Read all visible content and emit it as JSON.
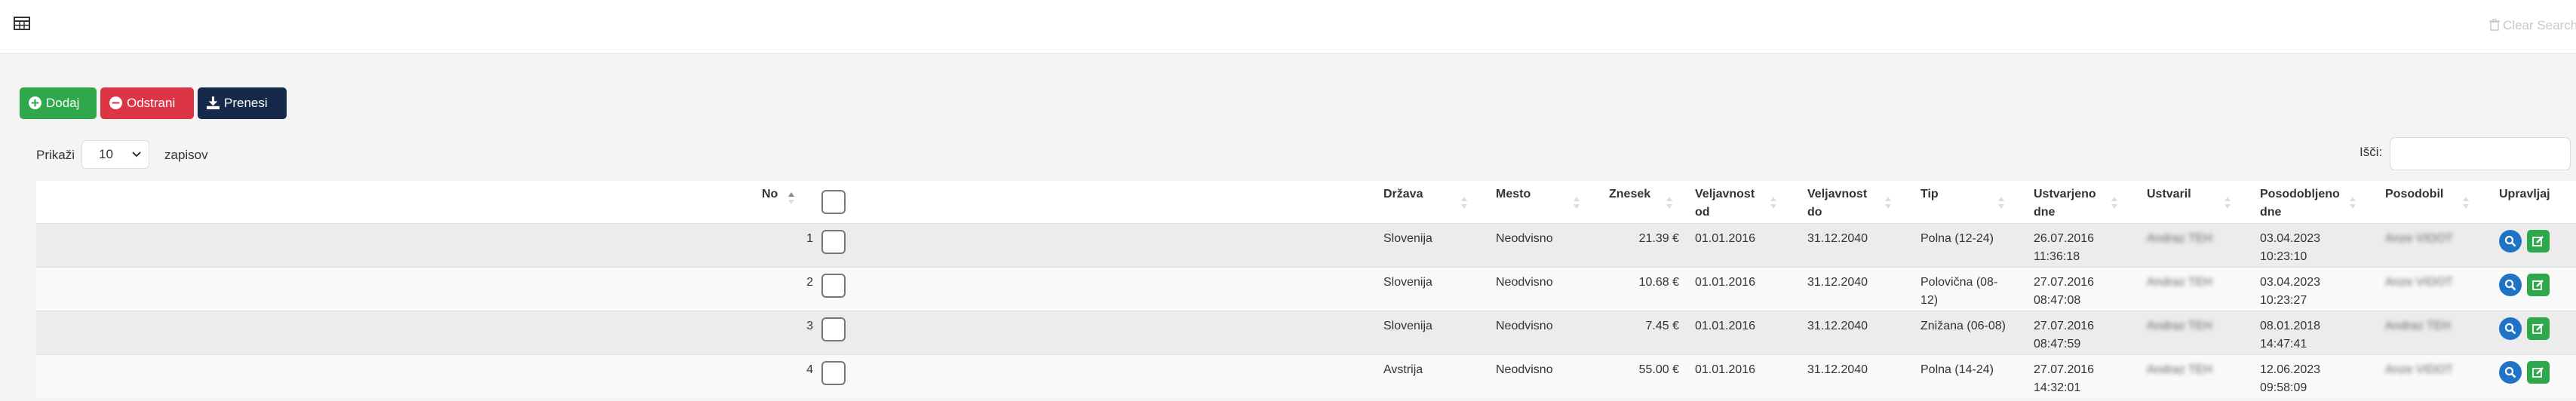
{
  "toolbar": {
    "clear_search_label": "Clear Search",
    "add_label": "Dodaj",
    "delete_label": "Odstrani",
    "download_label": "Prenesi"
  },
  "length": {
    "prefix": "Prikaži",
    "value": "10",
    "suffix": "zapisov"
  },
  "search": {
    "label": "Išči:",
    "value": ""
  },
  "columns": {
    "no": "No",
    "drzava": "Država",
    "mesto": "Mesto",
    "znesek": "Znesek",
    "velj_od": [
      "Veljavnost",
      "od"
    ],
    "velj_do": [
      "Veljavnost",
      "do"
    ],
    "tip": "Tip",
    "ustvarjeno": [
      "Ustvarjeno",
      "dne"
    ],
    "ustvaril": "Ustvaril",
    "posodobljeno": [
      "Posodobljeno",
      "dne"
    ],
    "posodobil": "Posodobil",
    "upravljaj": "Upravljaj"
  },
  "rows": [
    {
      "no": "1",
      "drzava": "Slovenija",
      "mesto": "Neodvisno",
      "znesek": "21.39 €",
      "od": "01.01.2016",
      "do": "31.12.2040",
      "tip": [
        "Polna (12-24)"
      ],
      "ustvarjeno": [
        "26.07.2016",
        "11:36:18"
      ],
      "ustvaril": "Andraz TEH",
      "posodobljeno": [
        "03.04.2023",
        "10:23:10"
      ],
      "posodobil": "Anze VIDOT"
    },
    {
      "no": "2",
      "drzava": "Slovenija",
      "mesto": "Neodvisno",
      "znesek": "10.68 €",
      "od": "01.01.2016",
      "do": "31.12.2040",
      "tip": [
        "Polovična (08-",
        "12)"
      ],
      "ustvarjeno": [
        "27.07.2016",
        "08:47:08"
      ],
      "ustvaril": "Andraz TEH",
      "posodobljeno": [
        "03.04.2023",
        "10:23:27"
      ],
      "posodobil": "Anze VIDOT"
    },
    {
      "no": "3",
      "drzava": "Slovenija",
      "mesto": "Neodvisno",
      "znesek": "7.45 €",
      "od": "01.01.2016",
      "do": "31.12.2040",
      "tip": [
        "Znižana (06-08)"
      ],
      "ustvarjeno": [
        "27.07.2016",
        "08:47:59"
      ],
      "ustvaril": "Andraz TEH",
      "posodobljeno": [
        "08.01.2018",
        "14:47:41"
      ],
      "posodobil": "Andraz TEH"
    },
    {
      "no": "4",
      "drzava": "Avstrija",
      "mesto": "Neodvisno",
      "znesek": "55.00 €",
      "od": "01.01.2016",
      "do": "31.12.2040",
      "tip": [
        "Polna (14-24)"
      ],
      "ustvarjeno": [
        "27.07.2016",
        "14:32:01"
      ],
      "ustvaril": "Andraz TEH",
      "posodobljeno": [
        "12.06.2023",
        "09:58:09"
      ],
      "posodobil": "Anze VIDOT"
    }
  ],
  "icons": {
    "grid": "table-grid-icon",
    "trash": "trash-icon",
    "add": "plus-circle-icon",
    "delete": "minus-circle-icon",
    "download": "download-icon",
    "view": "magnifier-icon",
    "edit": "edit-icon"
  },
  "colors": {
    "add": "#2ea84a",
    "delete": "#dc3545",
    "download": "#17294b",
    "view": "#1f73c7",
    "edit": "#2ea84a"
  }
}
